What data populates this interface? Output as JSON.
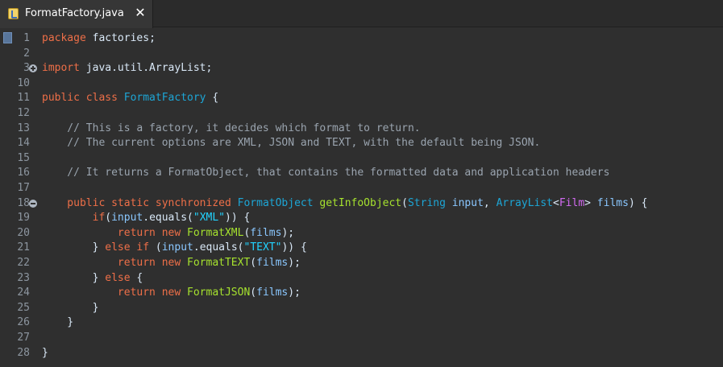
{
  "tab": {
    "title": "FormatFactory.java",
    "close": "✕",
    "icon": "java-file-icon"
  },
  "gutter": {
    "rows": [
      {
        "number": "1",
        "fold": ""
      },
      {
        "number": "2",
        "fold": ""
      },
      {
        "number": "3",
        "fold": "plus"
      },
      {
        "number": "10",
        "fold": ""
      },
      {
        "number": "11",
        "fold": ""
      },
      {
        "number": "12",
        "fold": ""
      },
      {
        "number": "13",
        "fold": ""
      },
      {
        "number": "14",
        "fold": ""
      },
      {
        "number": "15",
        "fold": ""
      },
      {
        "number": "16",
        "fold": ""
      },
      {
        "number": "17",
        "fold": ""
      },
      {
        "number": "18",
        "fold": "minus"
      },
      {
        "number": "19",
        "fold": ""
      },
      {
        "number": "20",
        "fold": ""
      },
      {
        "number": "21",
        "fold": ""
      },
      {
        "number": "22",
        "fold": ""
      },
      {
        "number": "23",
        "fold": ""
      },
      {
        "number": "24",
        "fold": ""
      },
      {
        "number": "25",
        "fold": ""
      },
      {
        "number": "26",
        "fold": ""
      },
      {
        "number": "27",
        "fold": ""
      },
      {
        "number": "28",
        "fold": ""
      }
    ]
  },
  "code": {
    "lines": [
      {
        "tokens": [
          {
            "text": "package",
            "cls": "kw"
          },
          {
            "text": " factories;",
            "cls": "plain"
          }
        ]
      },
      {
        "tokens": []
      },
      {
        "tokens": [
          {
            "text": "import",
            "cls": "kw"
          },
          {
            "text": " java.util.ArrayList;",
            "cls": "plain"
          }
        ]
      },
      {
        "tokens": []
      },
      {
        "tokens": [
          {
            "text": "public class ",
            "cls": "kw"
          },
          {
            "text": "FormatFactory",
            "cls": "cls"
          },
          {
            "text": " {",
            "cls": "plain"
          }
        ]
      },
      {
        "tokens": []
      },
      {
        "tokens": [
          {
            "text": "    // This is a factory, it decides which format to return.",
            "cls": "comment"
          }
        ]
      },
      {
        "tokens": [
          {
            "text": "    // The current options are XML, JSON and TEXT, with the default being JSON.",
            "cls": "comment"
          }
        ]
      },
      {
        "tokens": []
      },
      {
        "tokens": [
          {
            "text": "    // It returns a FormatObject, that contains the formatted data and application headers",
            "cls": "comment"
          }
        ]
      },
      {
        "tokens": []
      },
      {
        "tokens": [
          {
            "text": "    public static synchronized ",
            "cls": "kw"
          },
          {
            "text": "FormatObject",
            "cls": "cls"
          },
          {
            "text": " ",
            "cls": "plain"
          },
          {
            "text": "getInfoObject",
            "cls": "meth"
          },
          {
            "text": "(",
            "cls": "plain"
          },
          {
            "text": "String",
            "cls": "cls"
          },
          {
            "text": " input",
            "cls": "param"
          },
          {
            "text": ", ",
            "cls": "plain"
          },
          {
            "text": "ArrayList",
            "cls": "cls"
          },
          {
            "text": "<",
            "cls": "plain"
          },
          {
            "text": "Film",
            "cls": "generic"
          },
          {
            "text": ">",
            "cls": "plain"
          },
          {
            "text": " films",
            "cls": "param"
          },
          {
            "text": ") {",
            "cls": "plain"
          }
        ]
      },
      {
        "tokens": [
          {
            "text": "        if",
            "cls": "kw"
          },
          {
            "text": "(",
            "cls": "plain"
          },
          {
            "text": "input",
            "cls": "param"
          },
          {
            "text": ".equals(",
            "cls": "plain"
          },
          {
            "text": "\"XML\"",
            "cls": "str"
          },
          {
            "text": ")) {",
            "cls": "plain"
          }
        ]
      },
      {
        "tokens": [
          {
            "text": "            return new ",
            "cls": "kw"
          },
          {
            "text": "FormatXML",
            "cls": "meth"
          },
          {
            "text": "(",
            "cls": "plain"
          },
          {
            "text": "films",
            "cls": "param"
          },
          {
            "text": ");",
            "cls": "plain"
          }
        ]
      },
      {
        "tokens": [
          {
            "text": "        } ",
            "cls": "plain"
          },
          {
            "text": "else if",
            "cls": "kw"
          },
          {
            "text": " (",
            "cls": "plain"
          },
          {
            "text": "input",
            "cls": "param"
          },
          {
            "text": ".equals(",
            "cls": "plain"
          },
          {
            "text": "\"TEXT\"",
            "cls": "str"
          },
          {
            "text": ")) {",
            "cls": "plain"
          }
        ]
      },
      {
        "tokens": [
          {
            "text": "            return new ",
            "cls": "kw"
          },
          {
            "text": "FormatTEXT",
            "cls": "meth"
          },
          {
            "text": "(",
            "cls": "plain"
          },
          {
            "text": "films",
            "cls": "param"
          },
          {
            "text": ");",
            "cls": "plain"
          }
        ]
      },
      {
        "tokens": [
          {
            "text": "        } ",
            "cls": "plain"
          },
          {
            "text": "else",
            "cls": "kw"
          },
          {
            "text": " {",
            "cls": "plain"
          }
        ]
      },
      {
        "tokens": [
          {
            "text": "            return new ",
            "cls": "kw"
          },
          {
            "text": "FormatJSON",
            "cls": "meth"
          },
          {
            "text": "(",
            "cls": "plain"
          },
          {
            "text": "films",
            "cls": "param"
          },
          {
            "text": ");",
            "cls": "plain"
          }
        ]
      },
      {
        "tokens": [
          {
            "text": "        }",
            "cls": "plain"
          }
        ]
      },
      {
        "tokens": [
          {
            "text": "    }",
            "cls": "plain"
          }
        ]
      },
      {
        "tokens": []
      },
      {
        "tokens": [
          {
            "text": "}",
            "cls": "plain"
          }
        ]
      }
    ]
  }
}
